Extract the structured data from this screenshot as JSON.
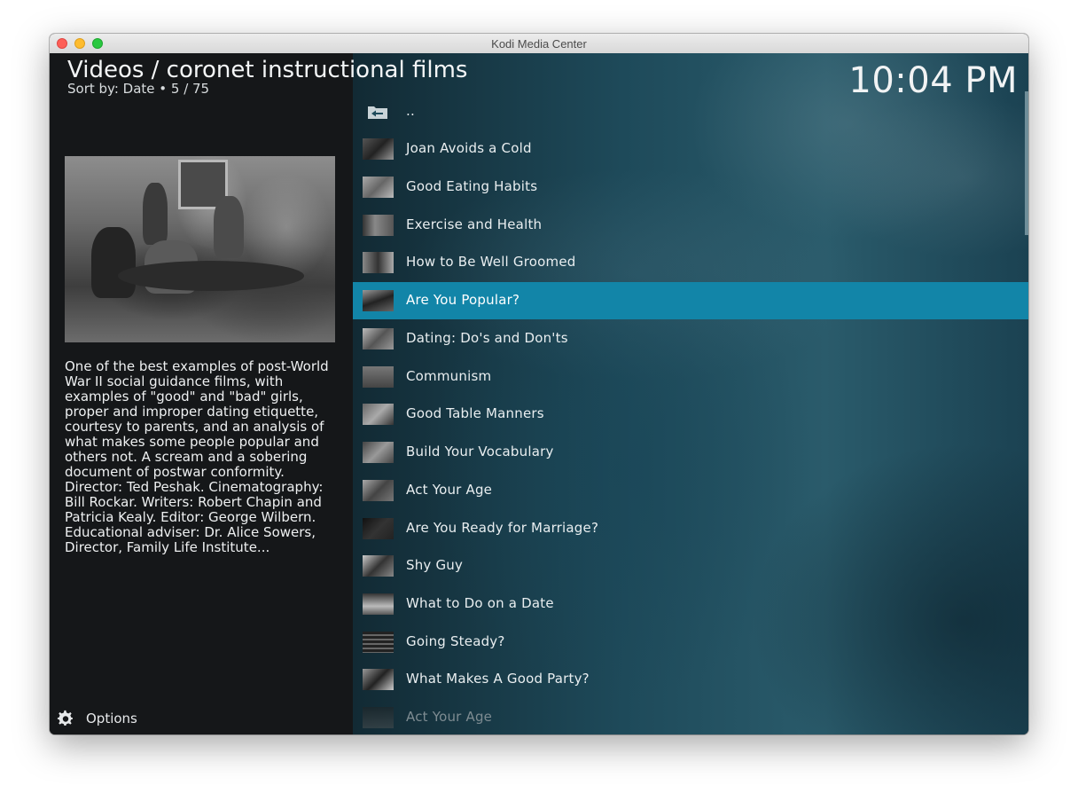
{
  "window": {
    "title": "Kodi Media Center"
  },
  "header": {
    "title": "Videos / coronet instructional films",
    "sort_text": "Sort by: Date  •  5 / 75",
    "clock": "10:04 PM"
  },
  "plot": "One of the best examples of post-World War II social guidance films, with examples of \"good\" and \"bad\" girls, proper and improper dating etiquette, courtesy to parents, and an analysis of what makes some people popular and others not. A scream and a sobering document of postwar conformity. Director: Ted Peshak. Cinematography: Bill Rockar. Writers: Robert Chapin and Patricia Kealy. Editor: George Wilbern. Educational adviser: Dr. Alice Sowers, Director, Family Life Institute...",
  "options": {
    "label": "Options",
    "icon": "gear-options-icon"
  },
  "list": {
    "parent": {
      "label": "..",
      "icon": "folder-back-icon"
    },
    "items": [
      {
        "label": "Joan Avoids a Cold",
        "selected": false
      },
      {
        "label": "Good Eating Habits",
        "selected": false
      },
      {
        "label": "Exercise and Health",
        "selected": false
      },
      {
        "label": "How to Be Well Groomed",
        "selected": false
      },
      {
        "label": "Are You Popular?",
        "selected": true
      },
      {
        "label": "Dating: Do's and Don'ts",
        "selected": false
      },
      {
        "label": "Communism",
        "selected": false
      },
      {
        "label": "Good Table Manners",
        "selected": false
      },
      {
        "label": "Build Your Vocabulary",
        "selected": false
      },
      {
        "label": "Act Your Age",
        "selected": false
      },
      {
        "label": "Are You Ready for Marriage?",
        "selected": false
      },
      {
        "label": "Shy Guy",
        "selected": false
      },
      {
        "label": "What to Do on a Date",
        "selected": false
      },
      {
        "label": "Going Steady?",
        "selected": false
      },
      {
        "label": "What Makes A Good Party?",
        "selected": false
      },
      {
        "label": "Act Your Age",
        "selected": false,
        "dimmed": true
      }
    ]
  },
  "colors": {
    "selection": "#1285a8",
    "left_panel": "#151719",
    "text": "#e9eef0"
  }
}
